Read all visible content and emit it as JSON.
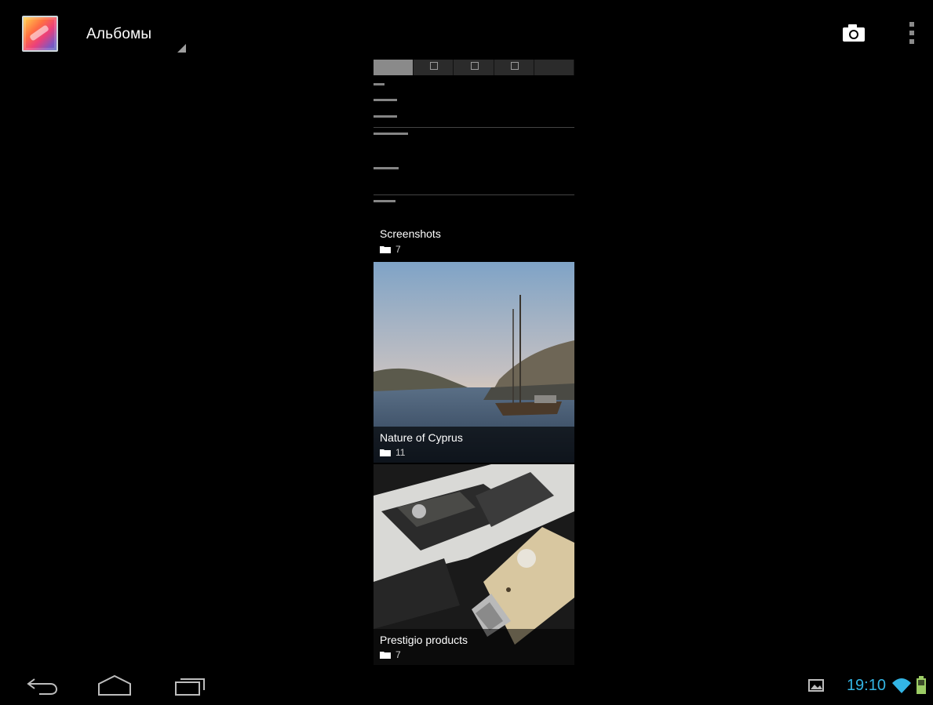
{
  "action_bar": {
    "title": "Альбомы",
    "icons": {
      "app": "gallery-app-icon",
      "camera": "camera-icon",
      "overflow": "overflow-menu-icon"
    }
  },
  "albums": [
    {
      "name": "Screenshots",
      "count": "7",
      "thumbnail": "screenshot-preview"
    },
    {
      "name": "Nature of Cyprus",
      "count": "11",
      "thumbnail": "sailboat-bay-photo"
    },
    {
      "name": "Prestigio products",
      "count": "7",
      "thumbnail": "usb-flash-drives-photo"
    }
  ],
  "navigation": {
    "buttons": [
      "back-icon",
      "home-icon",
      "recents-icon"
    ]
  },
  "status_bar": {
    "time": "19:10",
    "icons": [
      "gallery-notification-icon",
      "wifi-icon",
      "battery-icon"
    ]
  },
  "colors": {
    "background": "#000000",
    "clock": "#33b5e5",
    "text": "#ffffff"
  }
}
